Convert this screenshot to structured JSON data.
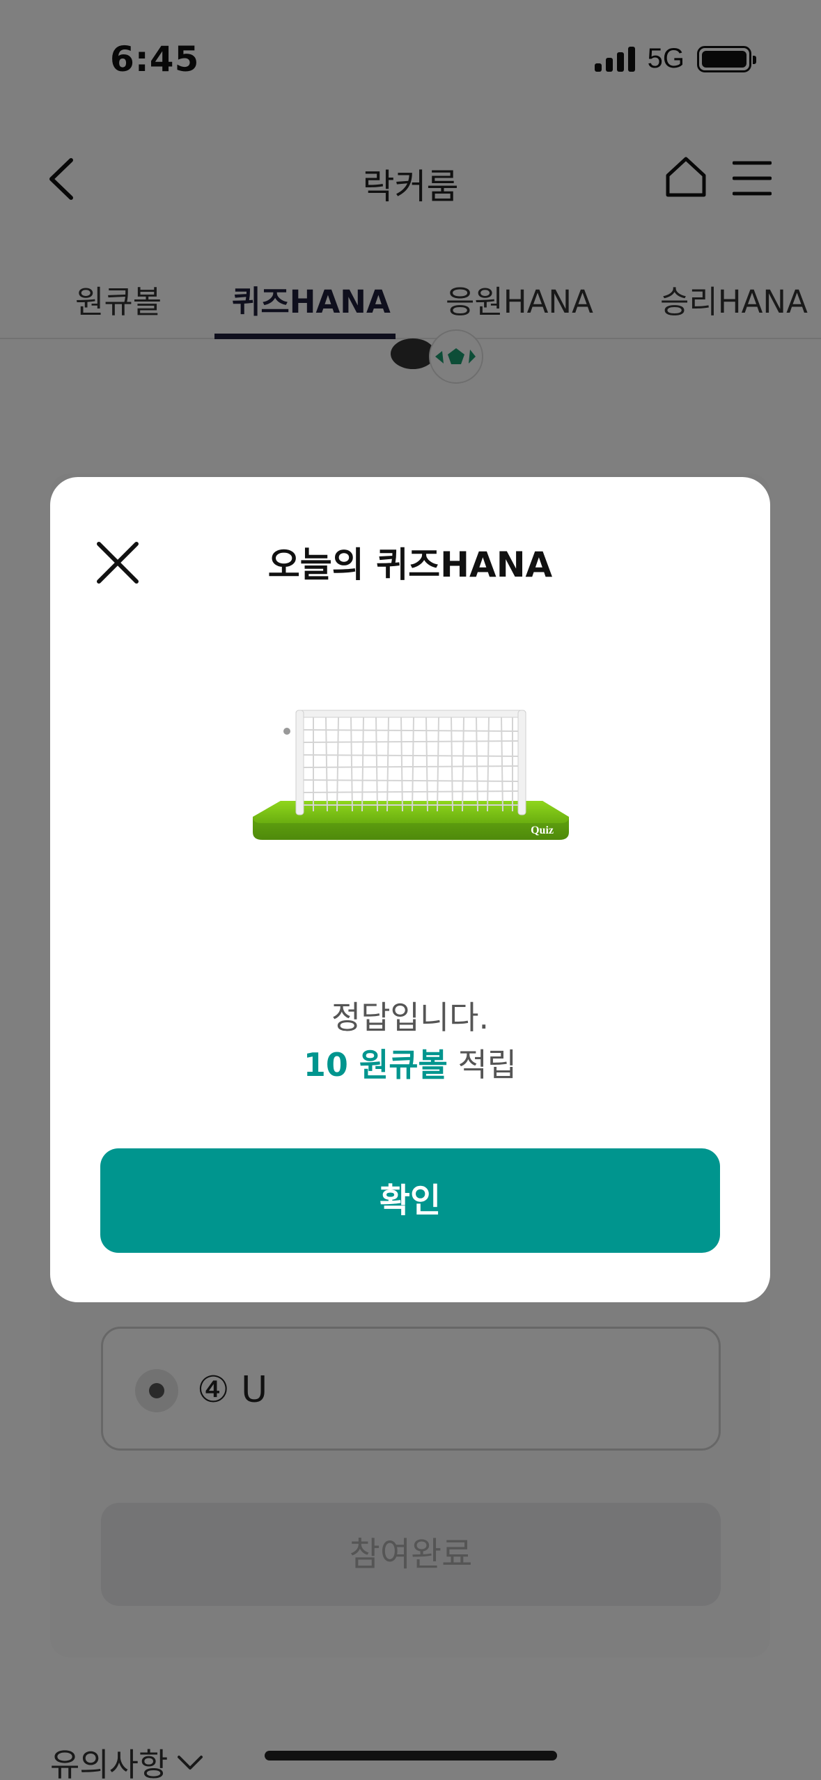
{
  "status_bar": {
    "time": "6:45",
    "network": "5G"
  },
  "header": {
    "title": "락커룸"
  },
  "tabs": [
    {
      "label": "원큐볼"
    },
    {
      "label": "퀴즈HANA"
    },
    {
      "label": "응원HANA"
    },
    {
      "label": "승리HANA"
    }
  ],
  "active_tab": "퀴즈HANA",
  "quiz": {
    "option4": "④ U",
    "submit_label": "참여완료"
  },
  "footer": {
    "notice_label": "유의사항"
  },
  "modal": {
    "title": "오늘의 퀴즈HANA",
    "goal_label": "Quiz",
    "message": "정답입니다.",
    "reward_amount": "10 원큐볼",
    "reward_suffix": " 적립",
    "confirm_label": "확인"
  },
  "colors": {
    "accent": "#00958e",
    "tab_active": "#1f1f3a",
    "goal_green": "#7cc614"
  },
  "icons": [
    "back-chevron-icon",
    "home-icon",
    "hamburger-menu-icon",
    "close-icon",
    "chevron-down-icon",
    "signal-icon",
    "battery-icon"
  ]
}
